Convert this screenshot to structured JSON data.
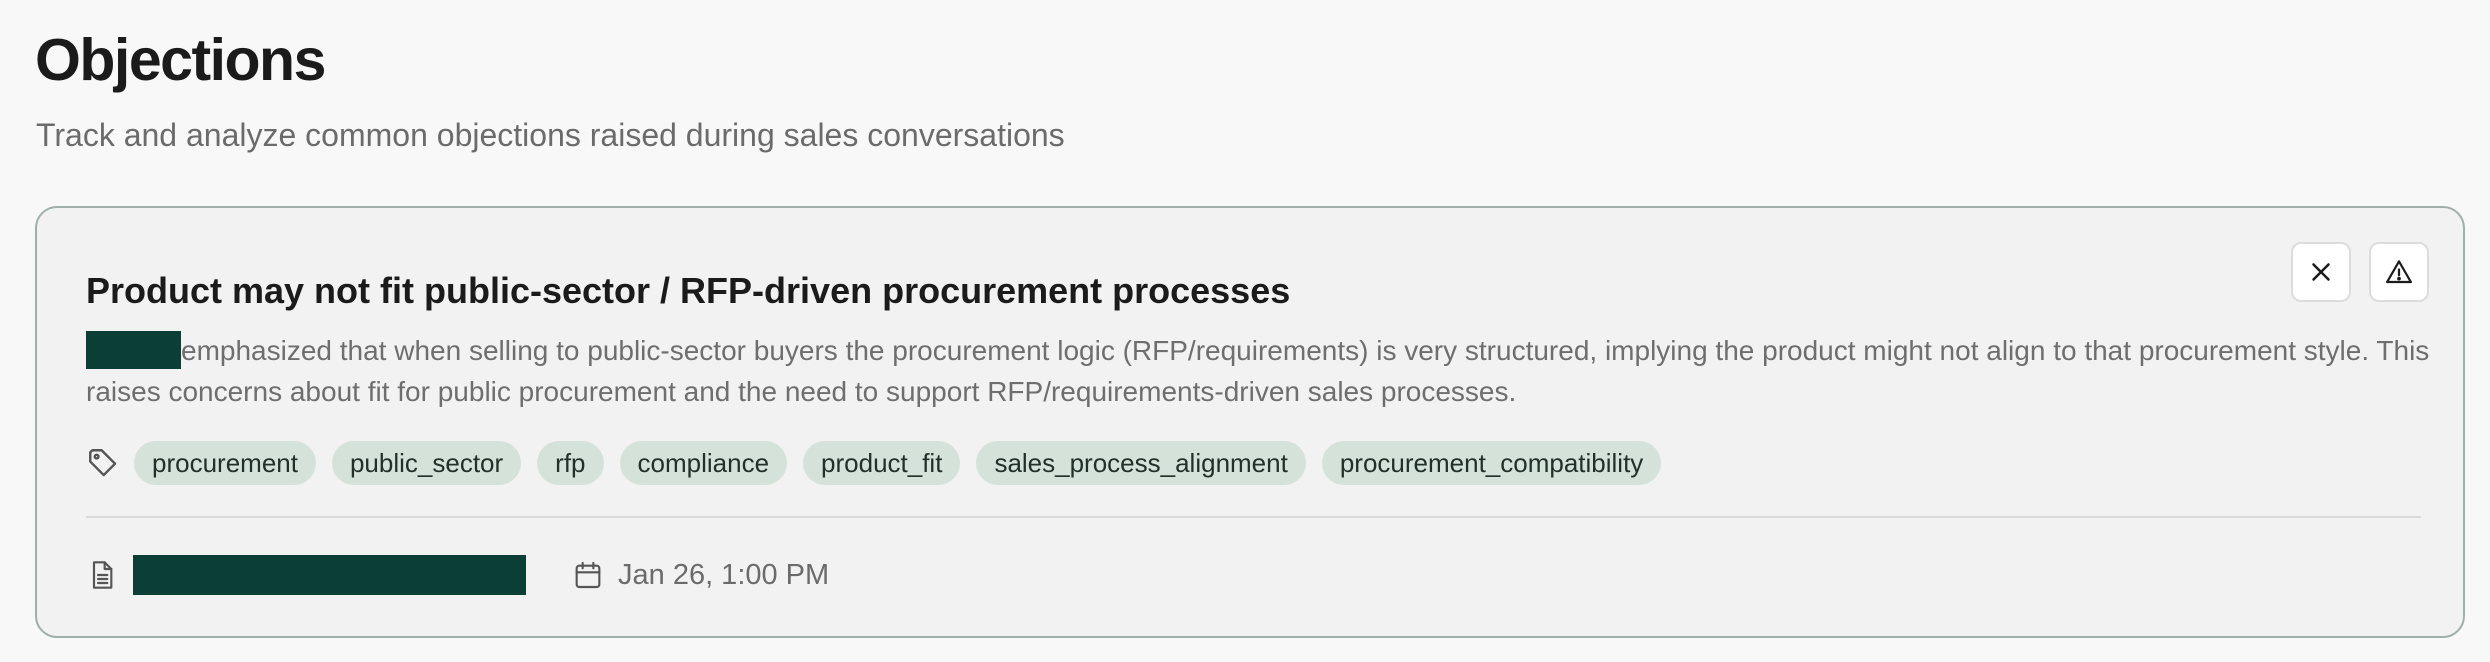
{
  "page": {
    "title": "Objections",
    "subtitle": "Track and analyze common objections raised during sales conversations"
  },
  "objection": {
    "title": "Product may not fit public-sector / RFP-driven procurement processes",
    "description": "emphasized that when selling to public-sector buyers the procurement logic (RFP/requirements) is very structured, implying the product might not align to that procurement style. This raises concerns about fit for public procurement and the need to support RFP/requirements-driven sales processes.",
    "tags": [
      "procurement",
      "public_sector",
      "rfp",
      "compliance",
      "product_fit",
      "sales_process_alignment",
      "procurement_compatibility"
    ],
    "date": "Jan 26, 1:00 PM",
    "actions": {
      "dismiss_icon": "close-icon",
      "flag_icon": "warning-triangle-icon"
    }
  },
  "colors": {
    "redaction": "#0b3f36",
    "tag_background": "#d5e2d9",
    "card_border": "#9fb0a8"
  }
}
